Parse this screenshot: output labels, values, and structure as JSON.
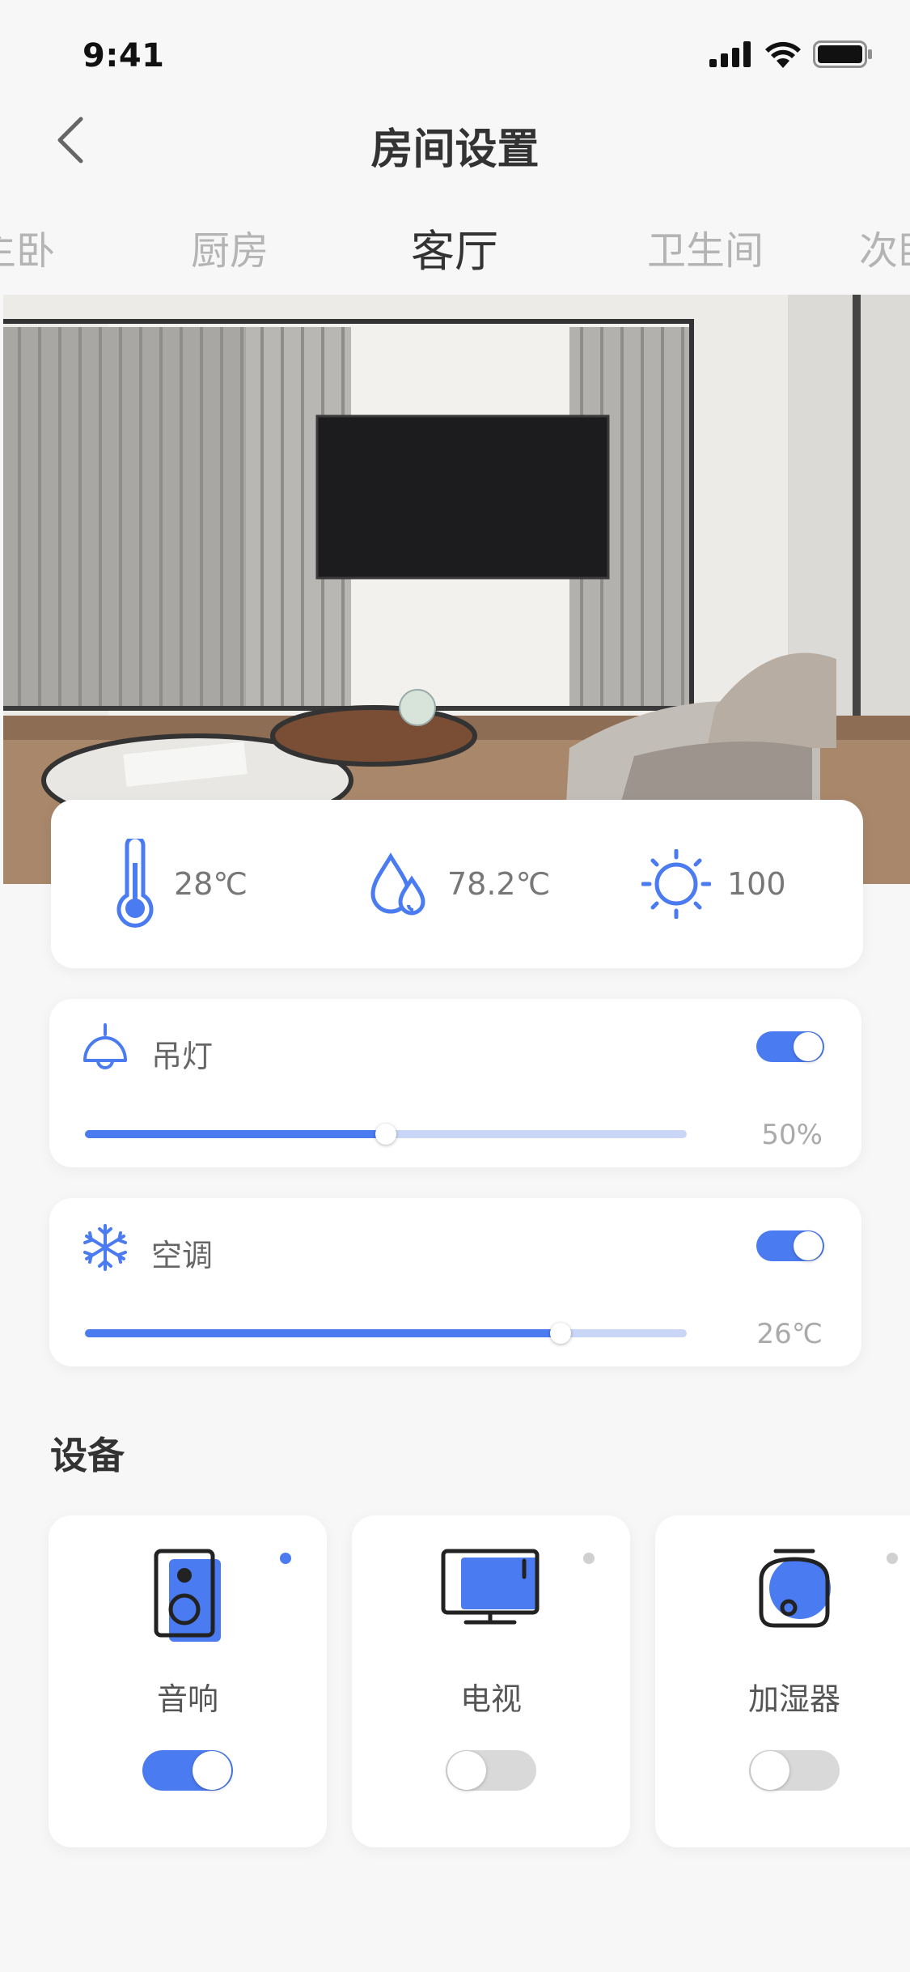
{
  "status_bar": {
    "time": "9:41"
  },
  "nav": {
    "title": "房间设置"
  },
  "tabs": [
    {
      "label": "主卧"
    },
    {
      "label": "厨房"
    },
    {
      "label": "客厅",
      "active": true
    },
    {
      "label": "卫生间"
    },
    {
      "label": "次卧"
    }
  ],
  "environment": {
    "temperature": "28℃",
    "humidity": "78.2℃",
    "brightness": "100"
  },
  "controls": {
    "light": {
      "label": "吊灯",
      "on": true,
      "level_percent": 50,
      "value_text": "50%"
    },
    "ac": {
      "label": "空调",
      "on": true,
      "level_fraction": 0.79,
      "value_text": "26℃"
    }
  },
  "devices": {
    "title": "设备",
    "items": [
      {
        "name": "音响",
        "icon": "speaker-icon",
        "on": true
      },
      {
        "name": "电视",
        "icon": "tv-icon",
        "on": false
      },
      {
        "name": "加湿器",
        "icon": "humidifier-icon",
        "on": false
      }
    ]
  },
  "colors": {
    "accent": "#4b7bf0",
    "accent_light": "#c9d6f7",
    "background": "#f7f7f7",
    "card": "#ffffff"
  }
}
